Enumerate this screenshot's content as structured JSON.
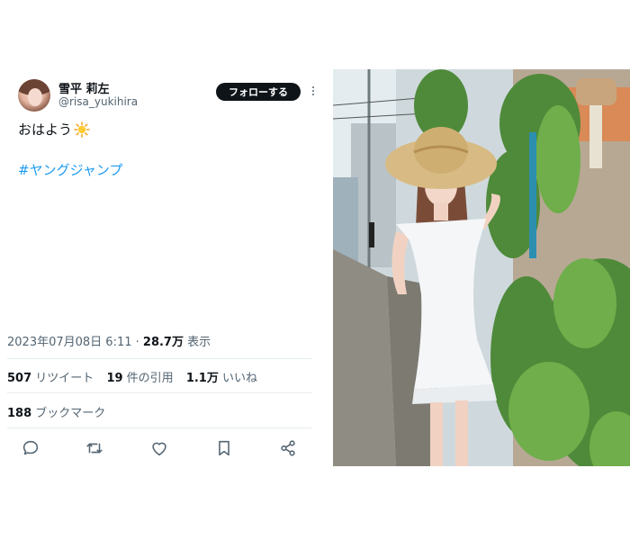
{
  "tweet": {
    "author_name": "雪平 莉左",
    "author_handle": "@risa_yukihira",
    "follow_label": "フォローする",
    "text": "おはよう",
    "text_emoji_icon": "sun-icon",
    "hashtag": "#ヤングジャンプ",
    "timestamp": "2023年07月08日 6:11",
    "separator": " · ",
    "views_count": "28.7万",
    "views_label": "表示",
    "retweets_count": "507",
    "retweets_label": "リツイート",
    "quotes_count": "19",
    "quotes_label": "件の引用",
    "likes_count": "1.1万",
    "likes_label": "いいね",
    "bookmarks_count": "188",
    "bookmarks_label": "ブックマーク",
    "actions": [
      "reply-icon",
      "retweet-icon",
      "like-icon",
      "bookmark-icon",
      "share-icon"
    ]
  },
  "colors": {
    "link": "#1d9bf0",
    "text": "#0f1419",
    "muted": "#536471",
    "follow_bg": "#0f1419"
  }
}
